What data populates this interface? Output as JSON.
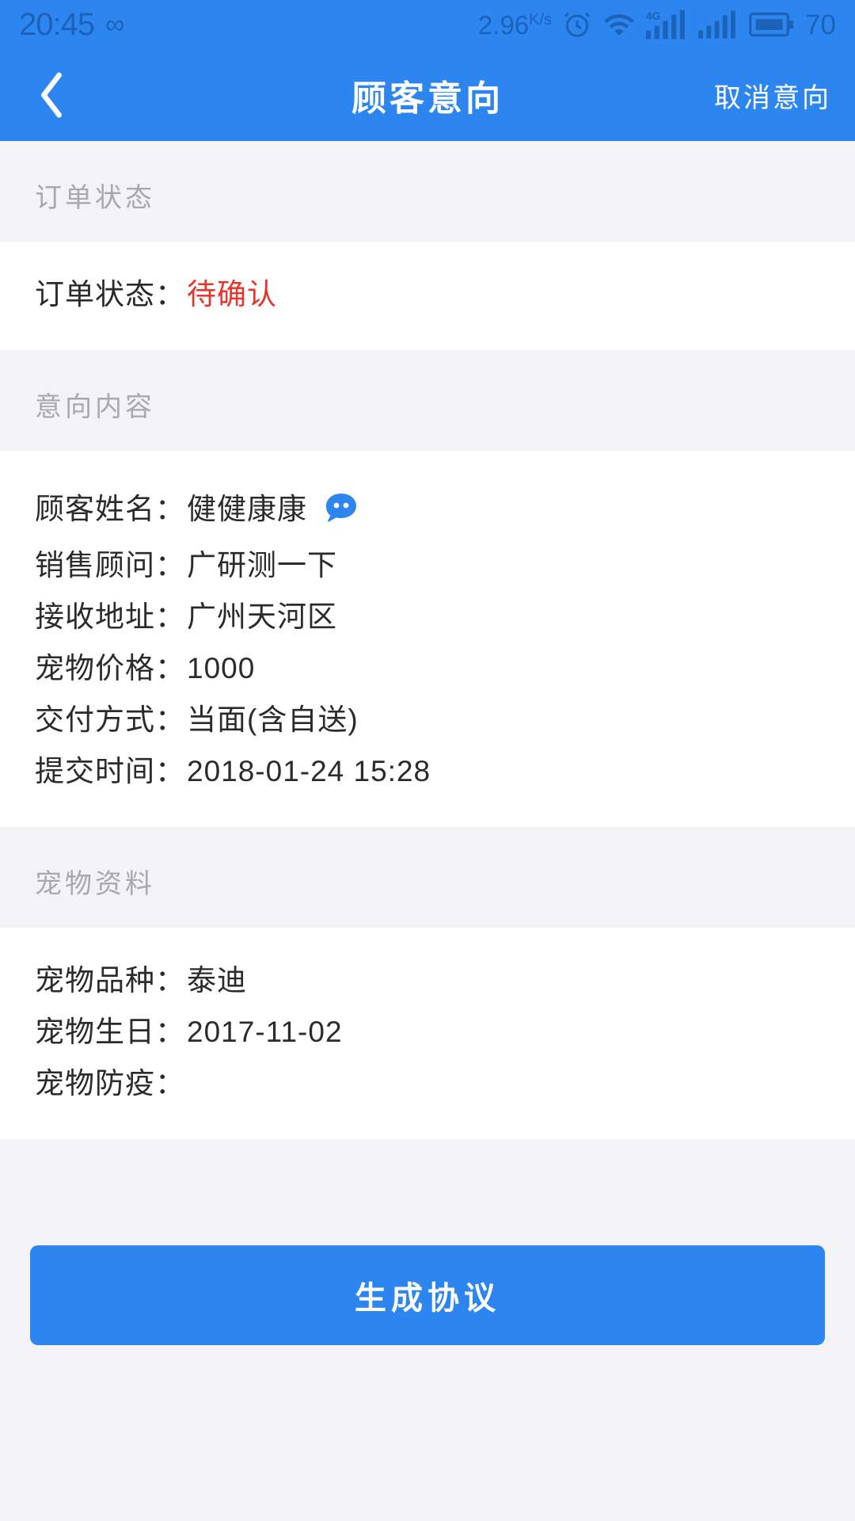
{
  "status_bar": {
    "time": "20:45",
    "infinity_icon": "infinity-icon",
    "network_speed": "2.96",
    "network_speed_unit": "K/s",
    "alarm_icon": "alarm-clock-icon",
    "wifi_icon": "wifi-download-icon",
    "signal_4g_icon": "signal-4g-icon",
    "signal_icon": "signal-bars-icon",
    "battery_icon": "battery-icon",
    "battery_level": "70"
  },
  "nav": {
    "back_icon": "chevron-left-icon",
    "title": "顾客意向",
    "action_label": "取消意向"
  },
  "sections": [
    {
      "header": "订单状态",
      "rows": [
        {
          "label": "订单状态：",
          "value": "待确认",
          "highlight": true
        }
      ]
    },
    {
      "header": "意向内容",
      "rows": [
        {
          "label": "顾客姓名：",
          "value": "健健康康",
          "chat": true
        },
        {
          "label": "销售顾问：",
          "value": "广研测一下"
        },
        {
          "label": "接收地址：",
          "value": "广州天河区"
        },
        {
          "label": "宠物价格：",
          "value": "1000"
        },
        {
          "label": "交付方式：",
          "value": "当面(含自送)"
        },
        {
          "label": "提交时间：",
          "value": "2018-01-24 15:28"
        }
      ]
    },
    {
      "header": "宠物资料",
      "rows": [
        {
          "label": "宠物品种：",
          "value": "泰迪"
        },
        {
          "label": "宠物生日：",
          "value": "2017-11-02"
        },
        {
          "label": "宠物防疫：",
          "value": ""
        }
      ]
    }
  ],
  "footer": {
    "primary_button": "生成协议"
  },
  "colors": {
    "brand_blue": "#2d85f0",
    "status_red": "#e8342b",
    "page_bg": "#f2f2f7",
    "card_bg": "#ffffff",
    "muted_text": "#a8a8b0"
  }
}
